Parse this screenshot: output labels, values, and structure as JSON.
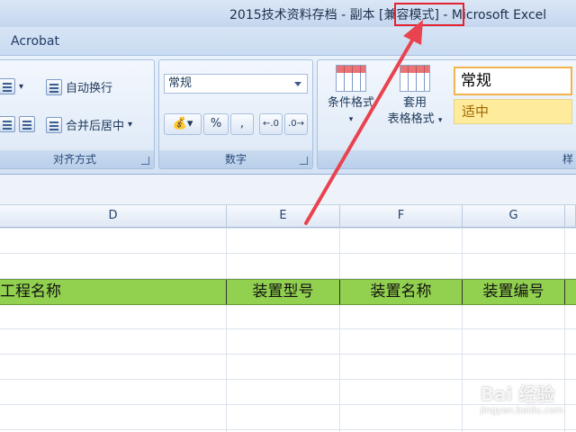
{
  "window": {
    "title": "2015技术资料存档 - 副本 [兼容模式] - Microsoft Excel"
  },
  "menubar": {
    "tab": "Acrobat"
  },
  "ribbon": {
    "alignment": {
      "wrap_text": "自动换行",
      "merge_center": "合并后居中",
      "label": "对齐方式"
    },
    "number": {
      "format_value": "常规",
      "percent": "%",
      "comma": ",",
      "label": "数字"
    },
    "styles": {
      "conditional_format": "条件格式",
      "table_format_line1": "套用",
      "table_format_line2": "表格格式",
      "normal": "常规",
      "neutral": "适中",
      "label": "样"
    }
  },
  "sheet": {
    "columns": [
      "D",
      "E",
      "F",
      "G"
    ],
    "header_row": [
      "工程名称",
      "装置型号",
      "装置名称",
      "装置编号"
    ]
  },
  "watermark": {
    "brand": "Bai 经验",
    "url": "jingyan.baidu.com"
  },
  "colors": {
    "header_fill": "#92d050",
    "highlight": "#e3222f",
    "neutral_fill": "#ffeb9c"
  }
}
